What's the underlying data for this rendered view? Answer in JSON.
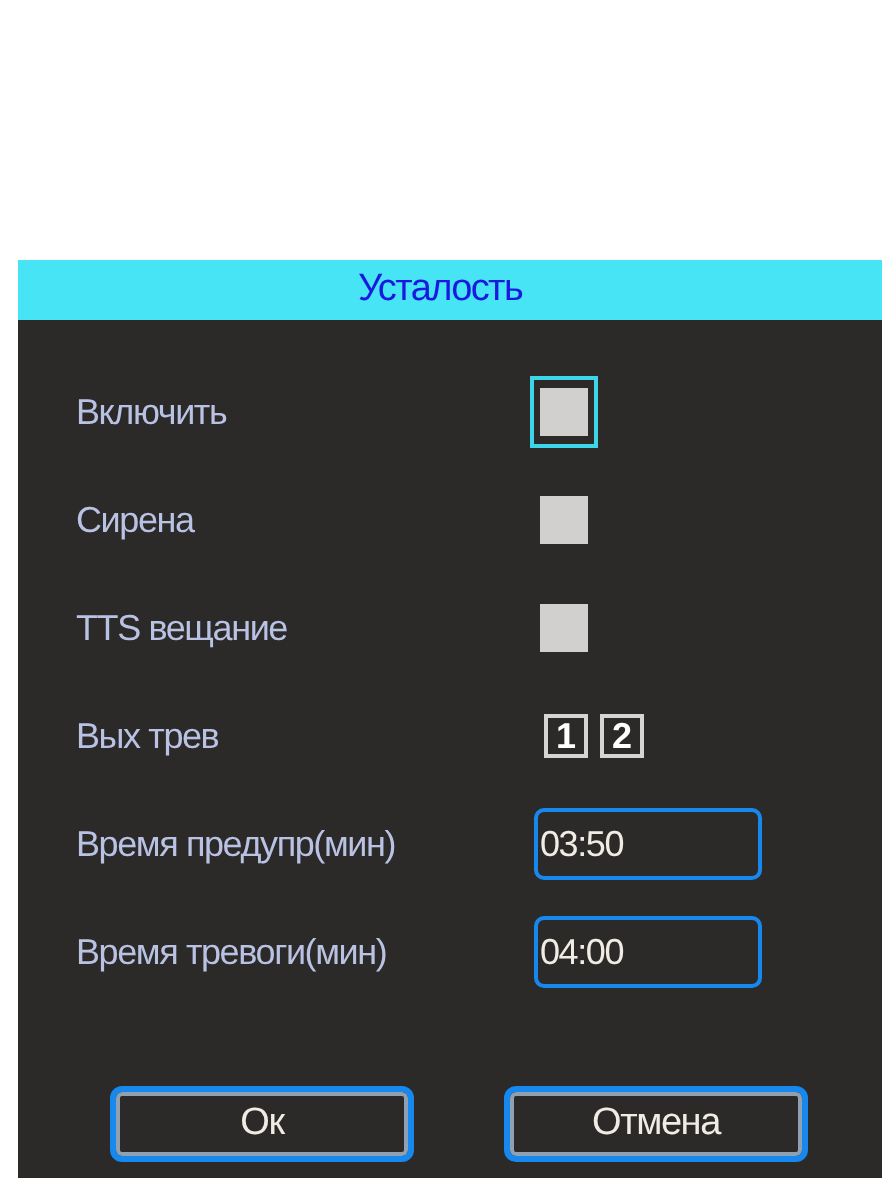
{
  "window": {
    "title": "Усталость"
  },
  "settings": [
    {
      "kind": "checkbox",
      "label": "Включить",
      "checked": false,
      "focused": true
    },
    {
      "kind": "checkbox",
      "label": "Сирена",
      "checked": false,
      "focused": false
    },
    {
      "kind": "checkbox",
      "label": "TTS вещание",
      "checked": false,
      "focused": false
    },
    {
      "kind": "outputs",
      "label": "Вых трев",
      "outputs": [
        "1",
        "2"
      ]
    },
    {
      "kind": "time",
      "label": "Время предупр(мин)",
      "value": "03:50"
    },
    {
      "kind": "time",
      "label": "Время тревоги(мин)",
      "value": "04:00"
    }
  ],
  "buttons": [
    "Ок",
    "Отмена"
  ]
}
